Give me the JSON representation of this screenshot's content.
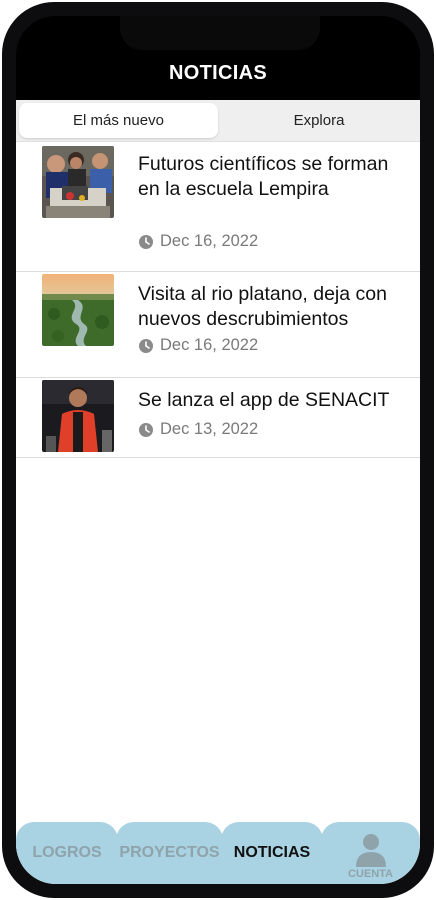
{
  "header": {
    "title": "NOTICIAS"
  },
  "tabs": [
    {
      "label": "El más nuevo",
      "active": true
    },
    {
      "label": "Explora",
      "active": false
    }
  ],
  "news": [
    {
      "title": "Futuros científicos se forman en la escuela Lempira",
      "date": "Dec 16, 2022",
      "thumbnail": "students-robotics-photo"
    },
    {
      "title": "Visita al rio platano, deja con nuevos descrubimientos",
      "date": "Dec 16, 2022",
      "thumbnail": "river-aerial-photo"
    },
    {
      "title": "Se lanza el app de SENACIT",
      "date": "Dec 13, 2022",
      "thumbnail": "speaker-photo"
    }
  ],
  "bottom_nav": [
    {
      "label": "LOGROS",
      "active": false
    },
    {
      "label": "PROYECTOS",
      "active": false
    },
    {
      "label": "NOTICIAS",
      "active": true
    },
    {
      "label": "CUENTA",
      "active": false,
      "icon": "person-icon"
    }
  ],
  "colors": {
    "header_bg": "#000000",
    "nav_bg": "#a9d2e2",
    "active_nav_text": "#111111",
    "inactive_nav_text": "#8fa3ab"
  }
}
